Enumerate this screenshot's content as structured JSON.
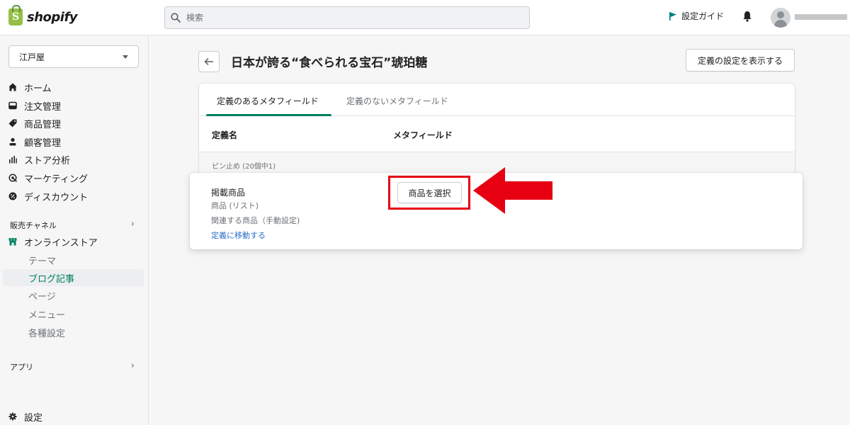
{
  "topbar": {
    "brand": "shopify",
    "search_placeholder": "検索",
    "setup_guide": "設定ガイド"
  },
  "sidebar": {
    "store_name": "江戸屋",
    "nav": [
      {
        "label": "ホーム",
        "icon": "home-icon"
      },
      {
        "label": "注文管理",
        "icon": "orders-icon"
      },
      {
        "label": "商品管理",
        "icon": "tag-icon"
      },
      {
        "label": "顧客管理",
        "icon": "person-icon"
      },
      {
        "label": "ストア分析",
        "icon": "analytics-icon"
      },
      {
        "label": "マーケティング",
        "icon": "target-icon"
      },
      {
        "label": "ディスカウント",
        "icon": "discount-icon"
      }
    ],
    "sales_channels_label": "販売チャネル",
    "online_store_label": "オンラインストア",
    "sub_items": [
      "テーマ",
      "ブログ記事",
      "ページ",
      "メニュー",
      "各種設定"
    ],
    "apps_label": "アプリ",
    "settings_label": "設定"
  },
  "main": {
    "title": "日本が誇る“食べられる宝石”琥珀糖",
    "view_definitions_button": "定義の設定を表示する",
    "tabs": [
      "定義のあるメタフィールド",
      "定義のないメタフィールド"
    ],
    "columns": [
      "定義名",
      "メタフィールド"
    ],
    "pinned_label": "ピン止め (20個中1)",
    "row": {
      "name": "掲載商品",
      "type": "商品 (リスト)",
      "description": "関連する商品（手動設定)",
      "link": "定義に移動する",
      "button": "商品を選択"
    }
  },
  "colors": {
    "accent": "#008060",
    "highlight": "#e60012",
    "link": "#2c6ecb"
  }
}
